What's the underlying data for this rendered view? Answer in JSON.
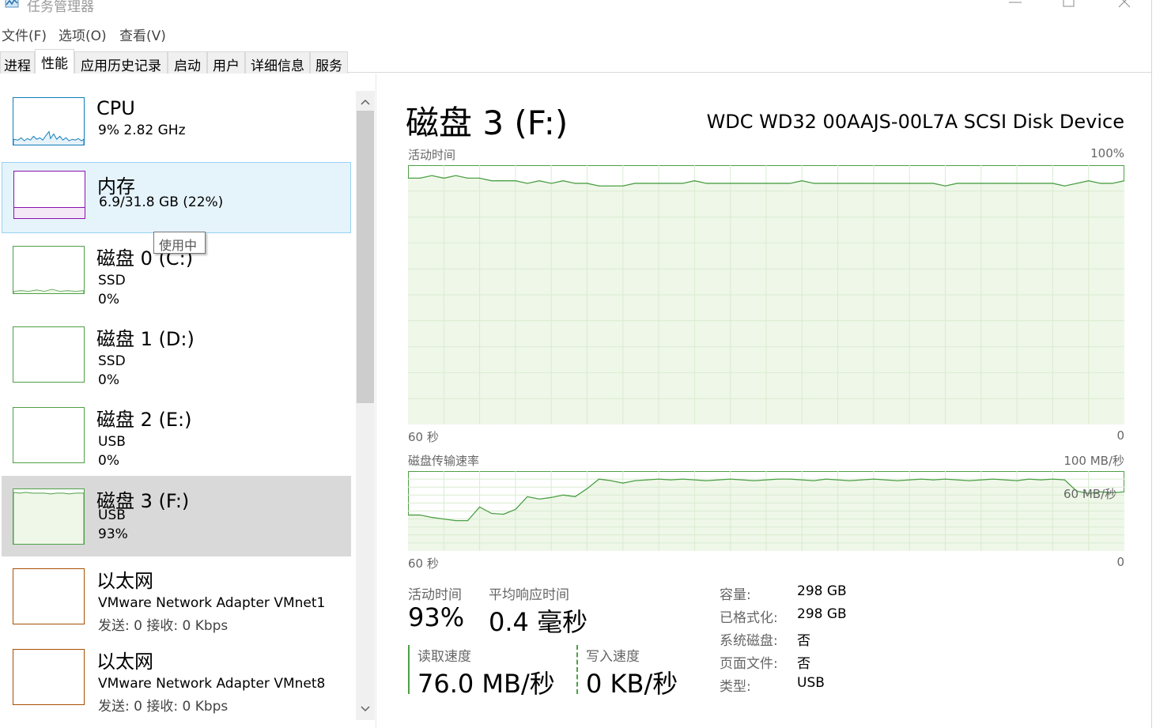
{
  "window": {
    "title": "任务管理器"
  },
  "menu": {
    "file": "文件(F)",
    "options": "选项(O)",
    "view": "查看(V)"
  },
  "tabs": [
    "进程",
    "性能",
    "应用历史记录",
    "启动",
    "用户",
    "详细信息",
    "服务"
  ],
  "colors": {
    "disk": "#4da046",
    "disk_fill": "#eff7e9",
    "cpu": "#117dbb",
    "memory": "#8b12ae",
    "ethernet": "#a74f01"
  },
  "sidebar": {
    "items": [
      {
        "name": "CPU",
        "line1": "9%  2.82 GHz",
        "line2": ""
      },
      {
        "name": "内存",
        "line1": "6.9/31.8 GB (22%)",
        "line2": ""
      },
      {
        "name": "磁盘 0 (C:)",
        "line1": "SSD",
        "line2": "0%"
      },
      {
        "name": "磁盘 1 (D:)",
        "line1": "SSD",
        "line2": "0%"
      },
      {
        "name": "磁盘 2 (E:)",
        "line1": "USB",
        "line2": "0%"
      },
      {
        "name": "磁盘 3 (F:)",
        "line1": "USB",
        "line2": "93%"
      },
      {
        "name": "以太网",
        "line1": "VMware Network Adapter VMnet1",
        "line2": "发送: 0 接收: 0 Kbps"
      },
      {
        "name": "以太网",
        "line1": "VMware Network Adapter VMnet8",
        "line2": "发送: 0 接收: 0 Kbps"
      }
    ],
    "tooltip": "使用中"
  },
  "main": {
    "title": "磁盘 3 (F:)",
    "device": "WDC WD32 00AAJS-00L7A SCSI Disk Device",
    "graph1": {
      "label": "活动时间",
      "max": "100%",
      "time_left": "60 秒",
      "time_right": "0"
    },
    "graph2": {
      "label": "磁盘传输速率",
      "max": "100 MB/秒",
      "mid": "60 MB/秒",
      "time_left": "60 秒",
      "time_right": "0"
    },
    "stats": {
      "active_label": "活动时间",
      "active_value": "93%",
      "resp_label": "平均响应时间",
      "resp_value": "0.4 毫秒",
      "read_label": "读取速度",
      "read_value": "76.0 MB/秒",
      "write_label": "写入速度",
      "write_value": "0 KB/秒"
    },
    "props": [
      {
        "k": "容量:",
        "v": "298 GB"
      },
      {
        "k": "已格式化:",
        "v": "298 GB"
      },
      {
        "k": "系统磁盘:",
        "v": "否"
      },
      {
        "k": "页面文件:",
        "v": "否"
      },
      {
        "k": "类型:",
        "v": "USB"
      }
    ]
  },
  "chart_data": [
    {
      "type": "area",
      "title": "活动时间",
      "ylim": [
        0,
        100
      ],
      "series": [
        {
          "values": [
            95,
            95,
            96,
            95,
            96,
            95,
            95,
            94,
            94,
            94,
            93,
            94,
            93,
            94,
            93,
            93,
            92,
            92,
            92,
            93,
            93,
            93,
            93,
            93,
            94,
            93,
            93,
            93,
            93,
            93,
            93,
            93,
            93,
            94,
            93,
            93,
            93,
            93,
            93,
            93,
            93,
            93,
            93,
            93,
            93,
            92,
            93,
            93,
            93,
            93,
            93,
            93,
            93,
            93,
            93,
            92,
            93,
            94,
            93,
            93,
            94
          ]
        }
      ]
    },
    {
      "type": "area",
      "title": "磁盘传输速率",
      "ylim": [
        0,
        100
      ],
      "series": [
        {
          "values": [
            45,
            45,
            42,
            40,
            38,
            38,
            55,
            47,
            46,
            52,
            68,
            65,
            67,
            70,
            68,
            78,
            90,
            88,
            85,
            88,
            89,
            90,
            89,
            90,
            89,
            88,
            89,
            90,
            89,
            88,
            89,
            90,
            90,
            89,
            88,
            90,
            89,
            88,
            89,
            90,
            89,
            88,
            89,
            90,
            89,
            90,
            89,
            88,
            89,
            90,
            89,
            88,
            90,
            89,
            90,
            89,
            75,
            72,
            74,
            73,
            74
          ]
        }
      ]
    }
  ]
}
